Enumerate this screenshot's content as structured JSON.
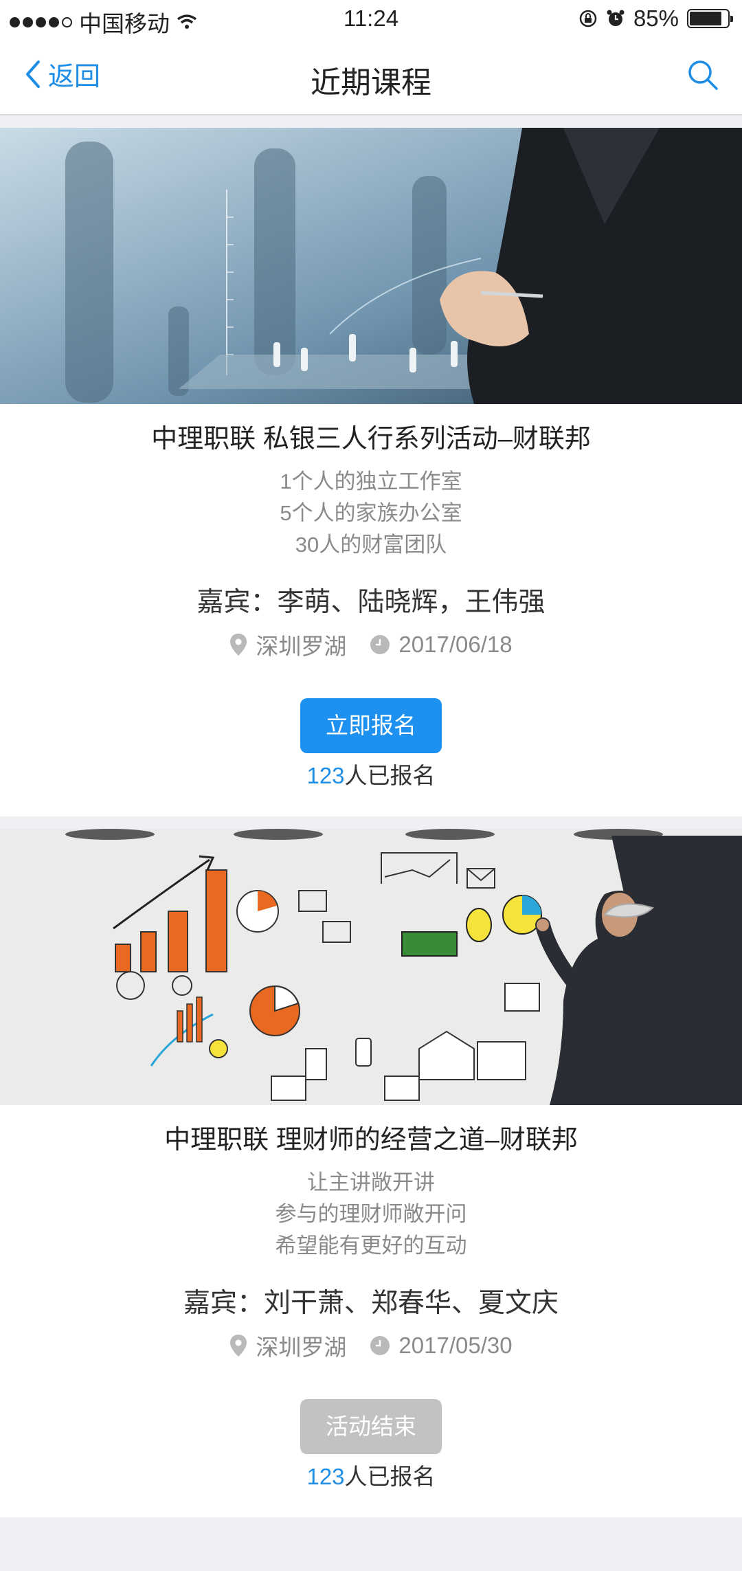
{
  "status_bar": {
    "carrier": "中国移动",
    "time": "11:24",
    "battery_percent": "85%",
    "battery_level": 0.85
  },
  "nav": {
    "back_label": "返回",
    "title": "近期课程"
  },
  "courses": [
    {
      "title": "中理职联 私银三人行系列活动–财联邦",
      "desc": [
        "1个人的独立工作室",
        "5个人的家族办公室",
        "30人的财富团队"
      ],
      "guests": "嘉宾：李萌、陆晓辉，王伟强",
      "location": "深圳罗湖",
      "date": "2017/06/18",
      "button_label": "立即报名",
      "signup_count": "123",
      "signup_suffix": "人已报名"
    },
    {
      "title": "中理职联 理财师的经营之道–财联邦",
      "desc": [
        "让主讲敞开讲",
        "参与的理财师敞开问",
        "希望能有更好的互动"
      ],
      "guests": "嘉宾：刘干萧、郑春华、夏文庆",
      "location": "深圳罗湖",
      "date": "2017/05/30",
      "button_label": "活动结束",
      "signup_count": "123",
      "signup_suffix": "人已报名"
    }
  ],
  "colors": {
    "accent": "#1e8de6",
    "button_active": "#1e90f0",
    "button_ended": "#c2c2c2",
    "background": "#efeff4"
  }
}
